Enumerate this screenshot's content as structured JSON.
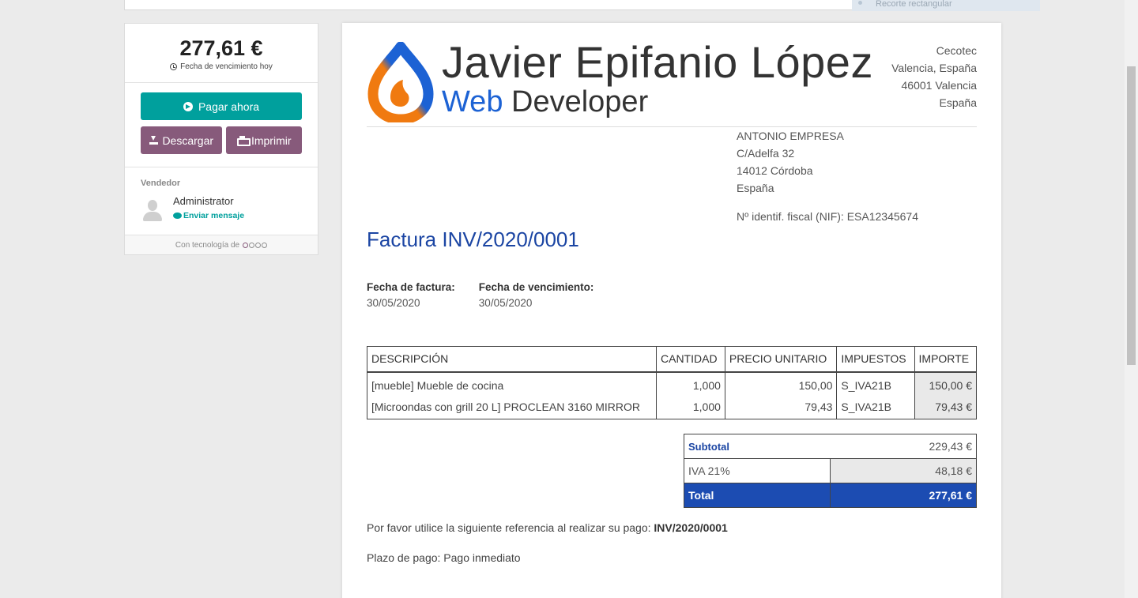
{
  "overlay": {
    "snip_hint": "Recorte rectangular"
  },
  "sidebar": {
    "amount": "277,61 €",
    "due_text": "Fecha de vencimiento hoy",
    "pay_label": "Pagar ahora",
    "download_label": "Descargar",
    "print_label": "Imprimir",
    "vendor_label": "Vendedor",
    "vendor_name": "Administrator",
    "message_label": "Enviar mensaje",
    "powered_by": "Con tecnología de"
  },
  "invoice": {
    "company": {
      "name": "Javier Epifanio López",
      "tagline_accent": "Web",
      "tagline_rest": "Developer",
      "address": [
        "Cecotec",
        "Valencia, España",
        "46001 Valencia",
        "España"
      ]
    },
    "partner": {
      "address": [
        "ANTONIO EMPRESA",
        "C/Adelfa 32",
        "14012 Córdoba",
        "España"
      ],
      "vat": "Nº identif. fiscal (NIF): ESA12345674"
    },
    "title": "Factura INV/2020/0001",
    "dates": {
      "invoice_label": "Fecha de factura:",
      "invoice_value": "30/05/2020",
      "due_label": "Fecha de vencimiento:",
      "due_value": "30/05/2020"
    },
    "table": {
      "headers": [
        "DESCRIPCIÓN",
        "CANTIDAD",
        "PRECIO UNITARIO",
        "IMPUESTOS",
        "IMPORTE"
      ],
      "rows": [
        [
          "[mueble] Mueble de cocina",
          "1,000",
          "150,00",
          "S_IVA21B",
          "150,00 €"
        ],
        [
          "[Microondas con grill 20 L] PROCLEAN 3160 MIRROR",
          "1,000",
          "79,43",
          "S_IVA21B",
          "79,43 €"
        ]
      ]
    },
    "totals": {
      "subtotal_label": "Subtotal",
      "subtotal_value": "229,43 €",
      "tax_label": "IVA 21%",
      "tax_value": "48,18 €",
      "total_label": "Total",
      "total_value": "277,61 €"
    },
    "ref_text": "Por favor utilice la siguiente referencia al realizar su pago:",
    "ref_value": "INV/2020/0001",
    "terms": "Plazo de pago: Pago inmediato"
  },
  "colors": {
    "primary": "#00a09d",
    "secondary": "#875a7b",
    "invoice_blue": "#1b45a3",
    "total_bg": "#1c4cb2",
    "logo_blue": "#1c62d4",
    "logo_orange": "#f07a10"
  }
}
